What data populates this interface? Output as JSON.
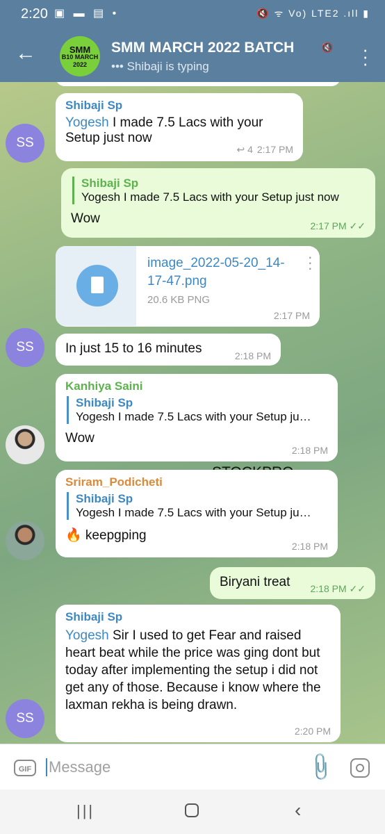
{
  "status_bar": {
    "time": "2:20",
    "right_icons": "🔇 ᯤ Vo) LTE2 .ıll ▮"
  },
  "header": {
    "title": "SMM MARCH 2022 BATCH",
    "subtitle": "••• Shibaji is typing",
    "avatar_text_1": "SMM",
    "avatar_text_2": "B10 MARCH",
    "avatar_text_3": "2022"
  },
  "watermark": "STOCKPRO",
  "messages": [
    {
      "sender": "Shibaji Sp",
      "mention": "Yogesh",
      "text": " I made 7.5 Lacs with your Setup just now",
      "reply_count": "4",
      "time": "2:17 PM",
      "avatar": "SS"
    },
    {
      "quote_name": "Shibaji Sp",
      "quote_text": "Yogesh I made 7.5 Lacs with your Setup just now",
      "text": "Wow",
      "time": "2:17 PM"
    },
    {
      "file_name": "image_2022-05-20_14-17-47.png",
      "file_size": "20.6 KB PNG",
      "time": "2:17 PM"
    },
    {
      "text": "In just 15 to 16 minutes",
      "time": "2:18 PM",
      "avatar": "SS"
    },
    {
      "sender": "Kanhiya Saini",
      "quote_name": "Shibaji Sp",
      "quote_text": "Yogesh I made 7.5 Lacs with your Setup ju…",
      "text": "Wow",
      "time": "2:18 PM"
    },
    {
      "sender": "Sriram_Podicheti",
      "quote_name": "Shibaji Sp",
      "quote_text": "Yogesh I made 7.5 Lacs with your Setup ju…",
      "text": "🔥 keepgping",
      "time": "2:18 PM"
    },
    {
      "text": "Biryani treat",
      "time": "2:18 PM"
    },
    {
      "sender": "Shibaji Sp",
      "mention": "Yogesh",
      "text": " Sir I used to get Fear and raised heart beat while the price was ging dont but today after implementing the setup i did not get any of those. Because i know where the laxman rekha is being drawn.",
      "time": "2:20 PM",
      "avatar": "SS"
    }
  ],
  "composer": {
    "gif_label": "GIF",
    "placeholder": "Message"
  },
  "colors": {
    "header": "#5b7f9e",
    "accent": "#3e88c2",
    "outgoing": "#e9fbd9",
    "avatar_ss": "#8c83df"
  }
}
